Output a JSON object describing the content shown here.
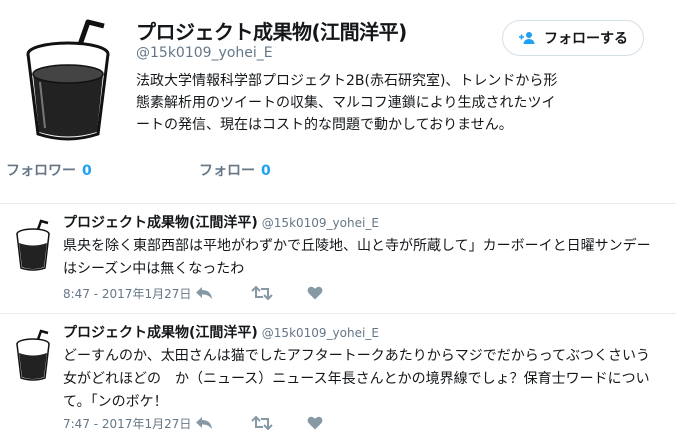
{
  "profile": {
    "name": "プロジェクト成果物(江間洋平)",
    "handle": "@15k0109_yohei_E",
    "bio": "法政大学情報科学部プロジェクト2B(赤石研究室)、トレンドから形態素解析用のツイートの収集、マルコフ連鎖により生成されたツイートの発信、現在はコスト的な問題で動かしておりません。",
    "follow_label": "フォローする"
  },
  "stats": {
    "followers_label": "フォロワー",
    "followers_count": "0",
    "following_label": "フォロー",
    "following_count": "0"
  },
  "tweets": [
    {
      "name": "プロジェクト成果物(江間洋平)",
      "handle": "@15k0109_yohei_E",
      "text": "県央を除く東部西部は平地がわずかで丘陵地、山と寺が所蔵して」カーボーイと日曜サンデーはシーズン中は無くなったわ",
      "time": "8:47 - 2017年1月27日"
    },
    {
      "name": "プロジェクト成果物(江間洋平)",
      "handle": "@15k0109_yohei_E",
      "text": "どーすんのか、太田さんは猫でしたアフタートークあたりからマジでだからってぶつくさいう女がどれほどの　か（ニュース）ニュース年長さんとかの境界線でしょ？保育士ワードについて。「ンのボケ！",
      "time": "7:47 - 2017年1月27日"
    }
  ],
  "icons": {
    "avatar": "glass-of-drink-with-straw",
    "follow": "add-user-icon",
    "reply": "reply-icon",
    "retweet": "retweet-icon",
    "like": "heart-icon"
  },
  "colors": {
    "accent": "#1da1f2",
    "muted": "#657786",
    "icon": "#8899a6",
    "border": "#e6ecf0"
  }
}
